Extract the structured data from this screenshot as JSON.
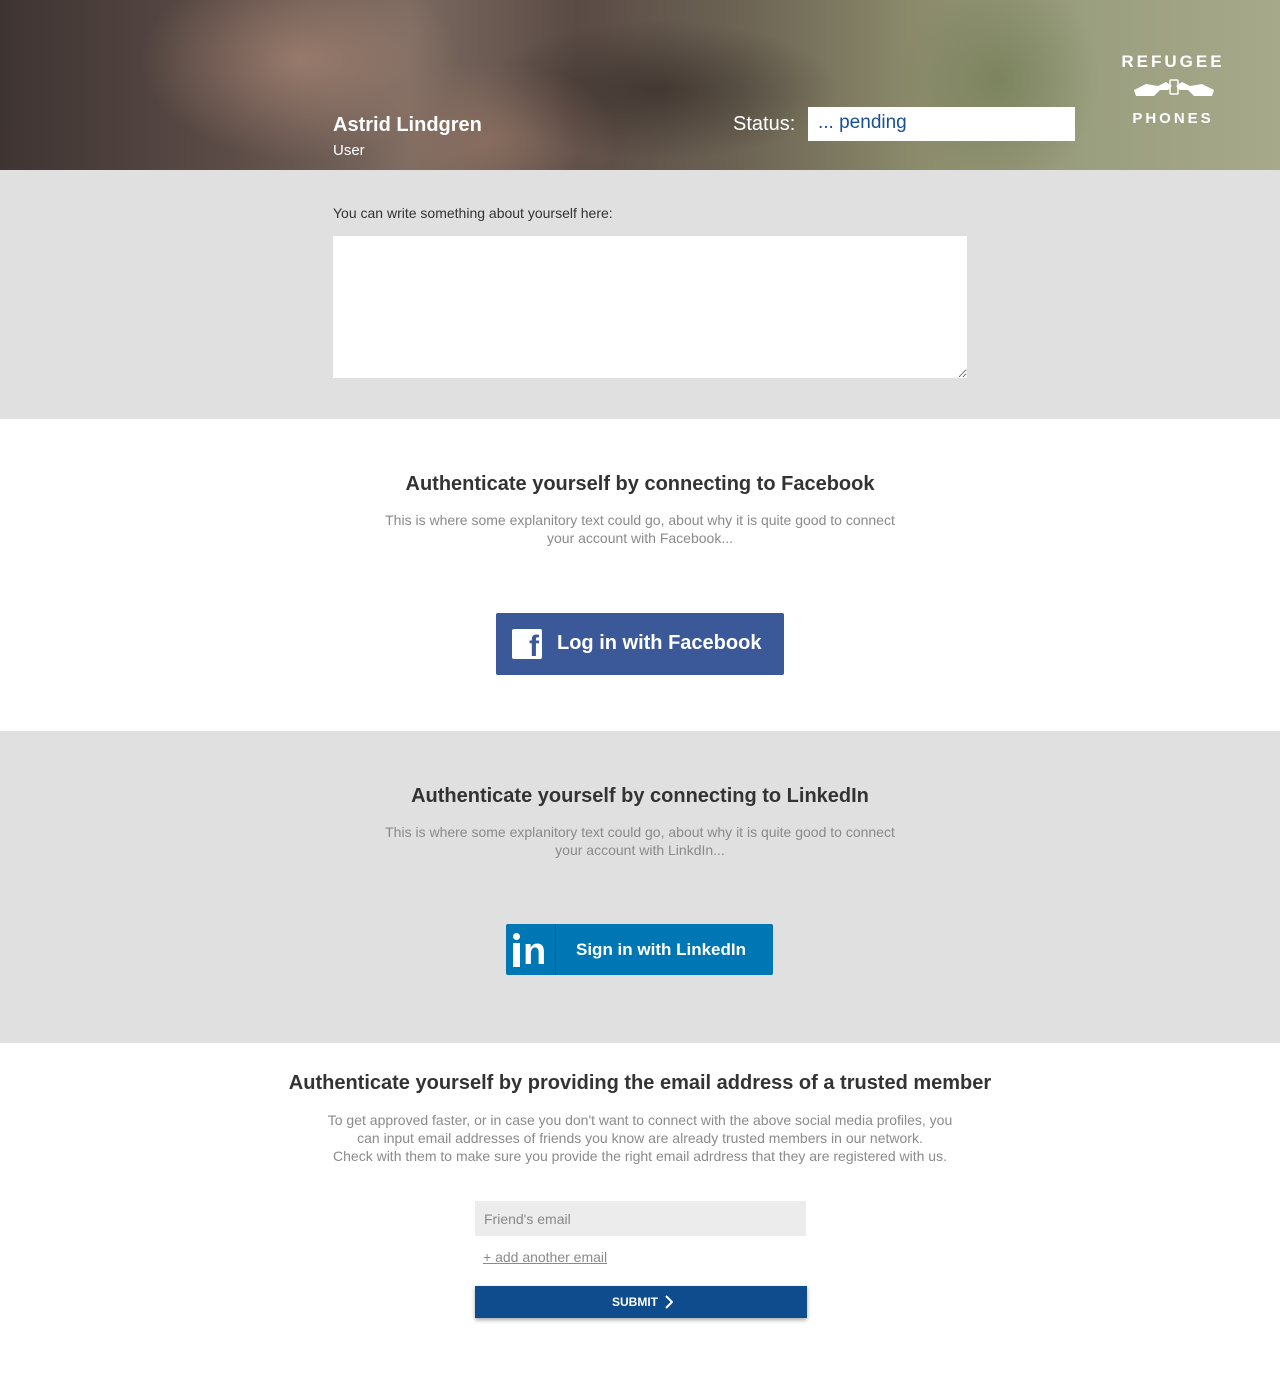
{
  "header": {
    "user_name": "Astrid Lindgren",
    "user_role": "User",
    "status_label": "Status:",
    "status_value": "... pending",
    "logo_top": "REFUGEE",
    "logo_bottom": "PHONES"
  },
  "about": {
    "label": "You can write something about yourself here:",
    "value": ""
  },
  "facebook": {
    "title": "Authenticate yourself by connecting to Facebook",
    "desc_line1": "This is where some explanitory text could go, about why it is quite good to connect",
    "desc_line2": "your account with Facebook...",
    "button_label": "Log in with Facebook",
    "icon": "facebook-icon",
    "color": "#3b5898"
  },
  "linkedin": {
    "title": "Authenticate yourself by connecting to LinkedIn",
    "desc_line1": "This is where some explanitory text could go, about why it is quite good to connect",
    "desc_line2": "your account with LinkdIn...",
    "button_label": "Sign in with LinkedIn",
    "icon": "linkedin-icon",
    "color": "#0077b5"
  },
  "email": {
    "title": "Authenticate yourself by providing the email address of a trusted member",
    "desc_line1": "To get approved faster, or in case you don't want to connect with the above social media profiles, you",
    "desc_line2": "can input email addresses of friends you know are already trusted members in our network.",
    "desc_line3": "Check with them to make sure you provide the right email adrdress that they are registered with us.",
    "input_placeholder": "Friend's email",
    "add_link": "+ add another email",
    "submit_label": "SUBMIT",
    "submit_color": "#0e4c8e"
  }
}
